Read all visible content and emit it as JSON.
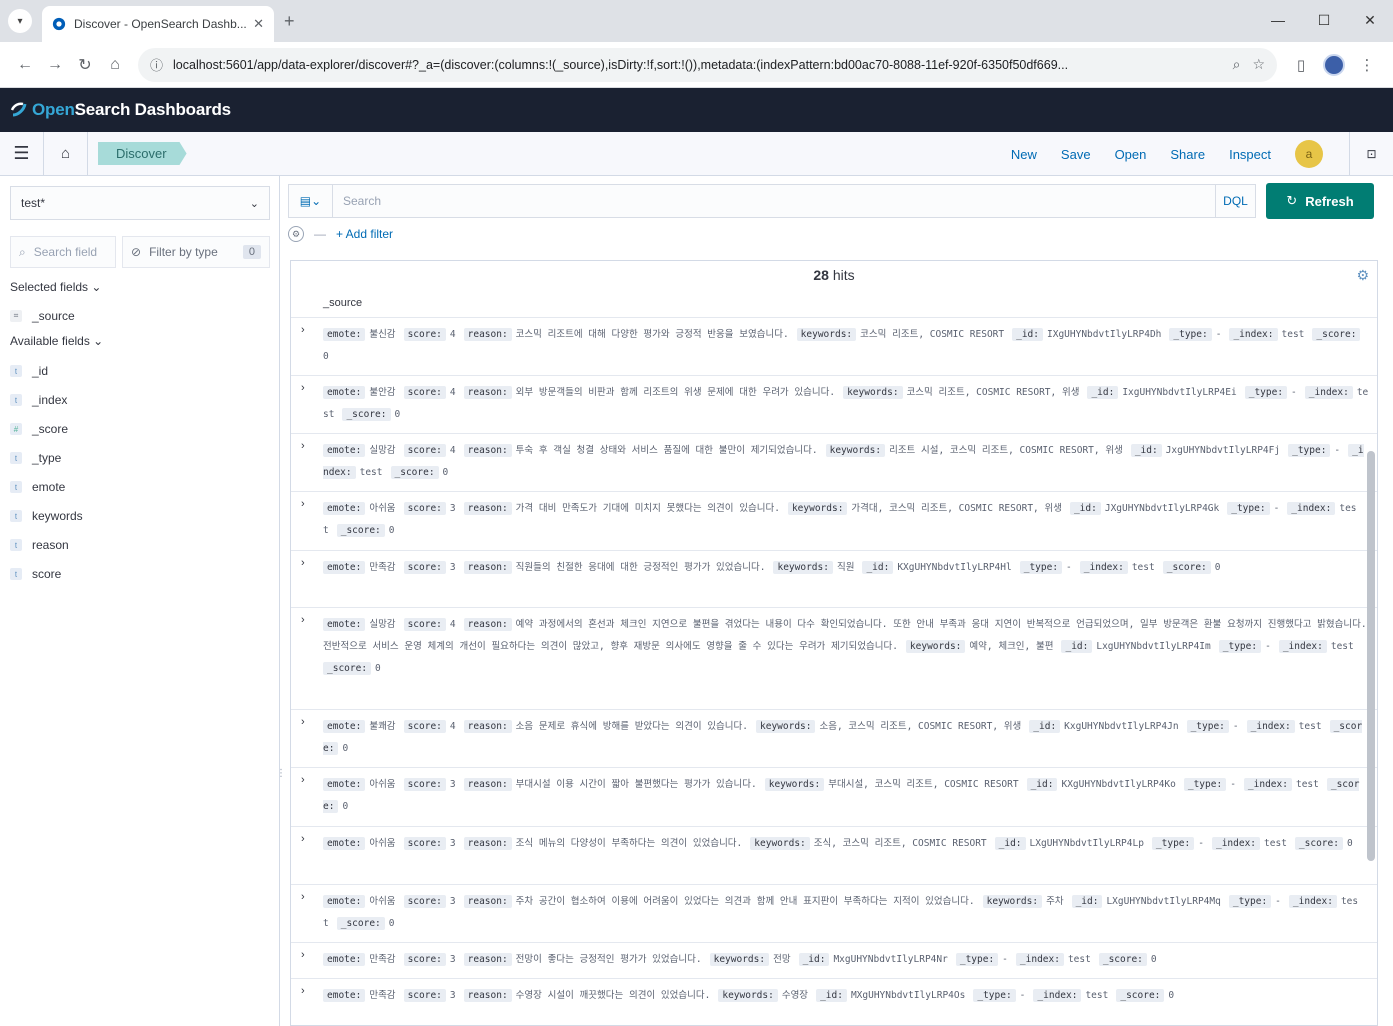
{
  "browser": {
    "tab_title": "Discover - OpenSearch Dashb...",
    "url": "localhost:5601/app/data-explorer/discover#?_a=(discover:(columns:!(_source),isDirty:!f,sort:!()),metadata:(indexPattern:bd00ac70-8088-11ef-920f-6350f50df669..."
  },
  "osd": {
    "logo_open": "Open",
    "logo_rest": "Search Dashboards",
    "breadcrumb": "Discover",
    "top_links": [
      "New",
      "Save",
      "Open",
      "Share",
      "Inspect"
    ],
    "user_initial": "a"
  },
  "sidebar": {
    "index_pattern": "test*",
    "search_placeholder": "Search field",
    "filter_by_type": "Filter by type",
    "filter_count": "0",
    "selected_title": "Selected fields",
    "selected_fields": [
      "_source"
    ],
    "available_title": "Available fields",
    "available_fields": [
      "_id",
      "_index",
      "_score",
      "_type",
      "emote",
      "keywords",
      "reason",
      "score"
    ]
  },
  "query": {
    "placeholder": "Search",
    "language": "DQL",
    "refresh_label": "Refresh",
    "add_filter": "+ Add filter"
  },
  "results": {
    "hits": "28",
    "hits_suffix": " hits",
    "column": "_source",
    "rows": [
      {
        "emote": "불신감",
        "score": "4",
        "reason": "코스믹 리조트에 대해 다양한 평가와 긍정적 반응을 보였습니다.",
        "keywords": "코스믹 리조트, COSMIC RESORT",
        "id": "IXgUHYNbdvtIlyLRP4Dh",
        "index": "test"
      },
      {
        "emote": "불안감",
        "score": "4",
        "reason": "외부 방문객들의 비판과 함께 리조트의 위생 문제에 대한 우려가 있습니다.",
        "keywords": "코스믹 리조트, COSMIC RESORT, 위생",
        "id": "IxgUHYNbdvtIlyLRP4Ei",
        "index": "test"
      },
      {
        "emote": "실망감",
        "score": "4",
        "reason": "투숙 후 객실 청결 상태와 서비스 품질에 대한 불만이 제기되었습니다.",
        "keywords": "리조트 시설, 코스믹 리조트, COSMIC RESORT, 위생",
        "id": "JxgUHYNbdvtIlyLRP4Fj",
        "index": "test"
      },
      {
        "emote": "아쉬움",
        "score": "3",
        "reason": "가격 대비 만족도가 기대에 미치지 못했다는 의견이 있습니다.",
        "keywords": "가격대, 코스믹 리조트, COSMIC RESORT, 위생",
        "id": "JXgUHYNbdvtIlyLRP4Gk",
        "index": "test"
      },
      {
        "emote": "만족감",
        "score": "3",
        "reason": "직원들의 친절한 응대에 대한 긍정적인 평가가 있었습니다.",
        "keywords": "직원",
        "id": "KXgUHYNbdvtIlyLRP4Hl",
        "index": "test"
      },
      {
        "emote": "실망감",
        "score": "4",
        "reason": "예약 과정에서의 혼선과 체크인 지연으로 불편을 겪었다는 내용이 다수 확인되었습니다. 또한 안내 부족과 응대 지연이 반복적으로 언급되었으며, 일부 방문객은 환불 요청까지 진행했다고 밝혔습니다. 전반적으로 서비스 운영 체계의 개선이 필요하다는 의견이 많았고, 향후 재방문 의사에도 영향을 줄 수 있다는 우려가 제기되었습니다.",
        "keywords": "예약, 체크인, 불편",
        "id": "LxgUHYNbdvtIlyLRP4Im",
        "index": "test"
      },
      {
        "emote": "불쾌감",
        "score": "4",
        "reason": "소음 문제로 휴식에 방해를 받았다는 의견이 있습니다.",
        "keywords": "소음, 코스믹 리조트, COSMIC RESORT, 위생",
        "id": "KxgUHYNbdvtIlyLRP4Jn",
        "index": "test"
      },
      {
        "emote": "아쉬움",
        "score": "3",
        "reason": "부대시설 이용 시간이 짧아 불편했다는 평가가 있습니다.",
        "keywords": "부대시설, 코스믹 리조트, COSMIC RESORT",
        "id": "KXgUHYNbdvtIlyLRP4Ko",
        "index": "test"
      },
      {
        "emote": "아쉬움",
        "score": "3",
        "reason": "조식 메뉴의 다양성이 부족하다는 의견이 있었습니다.",
        "keywords": "조식, 코스믹 리조트, COSMIC RESORT",
        "id": "LXgUHYNbdvtIlyLRP4Lp",
        "index": "test"
      },
      {
        "emote": "아쉬움",
        "score": "3",
        "reason": "주차 공간이 협소하여 이용에 어려움이 있었다는 의견과 함께 안내 표지판이 부족하다는 지적이 있었습니다.",
        "keywords": "주차",
        "id": "LXgUHYNbdvtIlyLRP4Mq",
        "index": "test"
      },
      {
        "emote": "만족감",
        "score": "3",
        "reason": "전망이 좋다는 긍정적인 평가가 있었습니다.",
        "keywords": "전망",
        "id": "MxgUHYNbdvtIlyLRP4Nr",
        "index": "test"
      },
      {
        "emote": "만족감",
        "score": "3",
        "reason": "수영장 시설이 깨끗했다는 의견이 있었습니다.",
        "keywords": "수영장",
        "id": "MXgUHYNbdvtIlyLRP4Os",
        "index": "test"
      }
    ]
  },
  "colors": {
    "header_bg": "#1a2131",
    "accent": "#017d73",
    "link": "#006bb4",
    "breadcrumb_bg": "#a7dbd9"
  }
}
